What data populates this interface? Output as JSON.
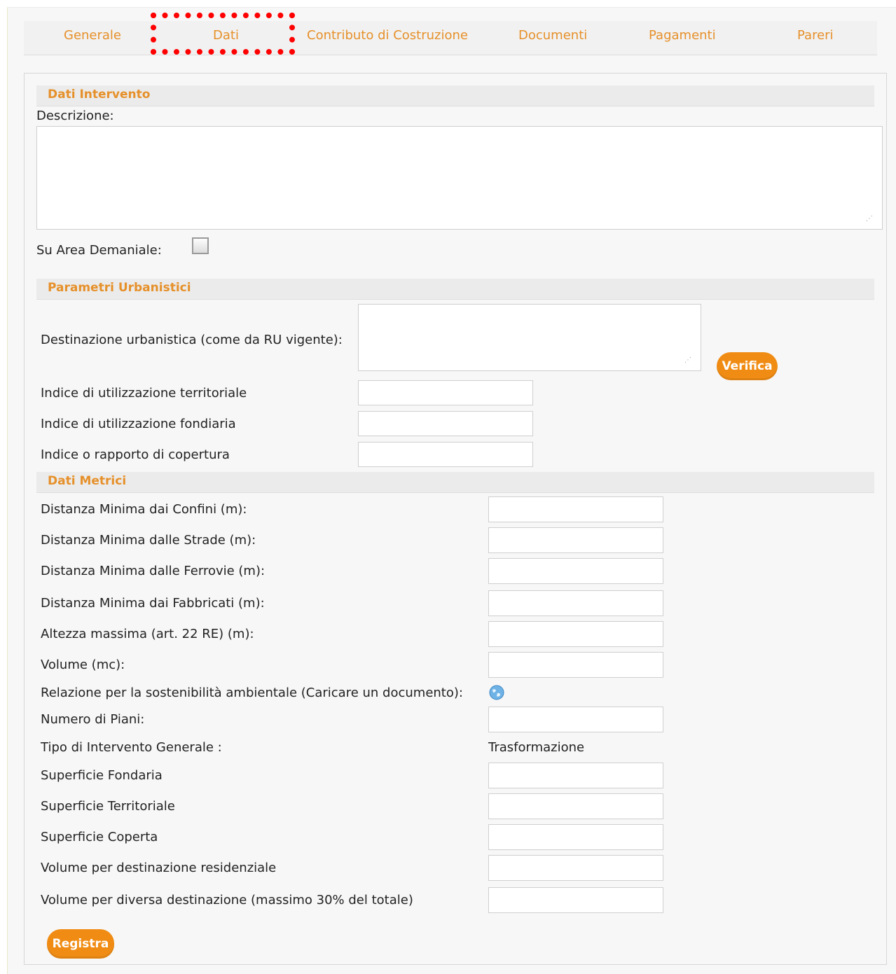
{
  "tabs": [
    {
      "label": "Generale"
    },
    {
      "label": "Dati"
    },
    {
      "label": "Contributo di Costruzione"
    },
    {
      "label": "Documenti"
    },
    {
      "label": "Pagamenti"
    },
    {
      "label": "Pareri"
    }
  ],
  "sections": {
    "dati_intervento": "Dati Intervento",
    "parametri_urbanistici": "Parametri Urbanistici",
    "dati_metrici": "Dati Metrici"
  },
  "fields": {
    "descrizione": {
      "label": "Descrizione:",
      "value": ""
    },
    "area_demaniale": {
      "label": "Su Area Demaniale:",
      "checked": false
    },
    "destinazione": {
      "label": "Destinazione urbanistica (come da RU vigente):",
      "value": ""
    },
    "indice_territoriale": {
      "label": "Indice di utilizzazione territoriale",
      "value": ""
    },
    "indice_fondiaria": {
      "label": "Indice di utilizzazione fondiaria",
      "value": ""
    },
    "indice_copertura": {
      "label": "Indice o rapporto di copertura",
      "value": ""
    },
    "dist_confini": {
      "label": "Distanza Minima dai Confini (m):",
      "value": ""
    },
    "dist_strade": {
      "label": "Distanza Minima dalle Strade (m):",
      "value": ""
    },
    "dist_ferrovie": {
      "label": "Distanza Minima dalle Ferrovie (m):",
      "value": ""
    },
    "dist_fabbricati": {
      "label": "Distanza Minima dai Fabbricati (m):",
      "value": ""
    },
    "altezza": {
      "label": "Altezza massima (art. 22 RE) (m):",
      "value": ""
    },
    "volume": {
      "label": "Volume (mc):",
      "value": ""
    },
    "relazione": {
      "label": "Relazione per la sostenibilità ambientale (Caricare un documento):",
      "icon": "globe-icon"
    },
    "piani": {
      "label": "Numero di Piani:",
      "value": ""
    },
    "tipo_intervento": {
      "label": "Tipo di Intervento Generale :",
      "value": "Trasformazione"
    },
    "sup_fondaria": {
      "label": "Superficie Fondaria",
      "value": ""
    },
    "sup_territoriale": {
      "label": "Superficie Territoriale",
      "value": ""
    },
    "sup_coperta": {
      "label": "Superficie Coperta",
      "value": ""
    },
    "vol_residenziale": {
      "label": "Volume per destinazione residenziale",
      "value": ""
    },
    "vol_diversa": {
      "label": "Volume per diversa destinazione (massimo 30% del totale)",
      "value": ""
    }
  },
  "buttons": {
    "verifica": "Verifica",
    "registra": "Registra"
  },
  "colors": {
    "accent": "#e6902a",
    "button": "#f08c14",
    "highlight": "#ff0000"
  }
}
